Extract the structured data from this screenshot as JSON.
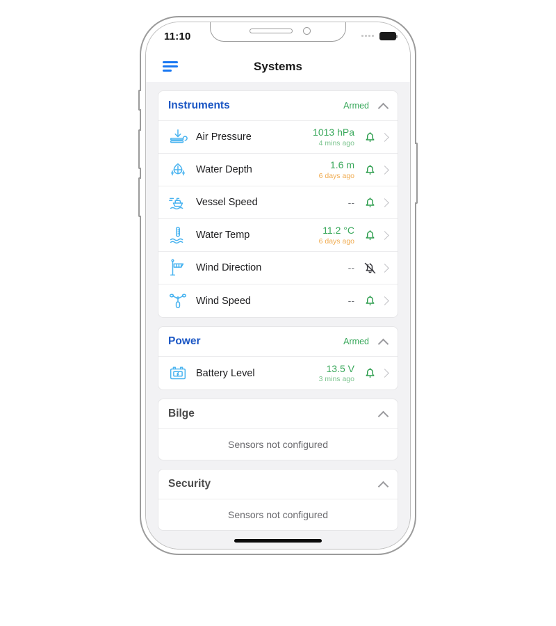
{
  "status_bar": {
    "time": "11:10",
    "signal_icon": "signal-dots-icon",
    "battery_icon": "battery-full-icon"
  },
  "navbar": {
    "menu_icon": "hamburger-menu-icon",
    "title": "Systems"
  },
  "colors": {
    "accent_blue": "#1a56c4",
    "menu_blue": "#1877f2",
    "armed_green": "#39a85b",
    "value_green": "#39a85b",
    "stale_orange": "#f0ab50",
    "icon_blue": "#48b3f0",
    "screen_bg": "#f2f2f4"
  },
  "sections": [
    {
      "title": "Instruments",
      "title_color": "blue",
      "status": "Armed",
      "collapse_icon": "chevron-up-icon",
      "rows": [
        {
          "icon": "air-pressure-icon",
          "label": "Air Pressure",
          "value": "1013 hPa",
          "time": "4 mins ago",
          "time_state": "fresh",
          "value_state": "active",
          "bell": "bell-icon",
          "chevron": "chevron-right-icon"
        },
        {
          "icon": "water-depth-icon",
          "label": "Water Depth",
          "value": "1.6 m",
          "time": "6 days ago",
          "time_state": "stale",
          "value_state": "active",
          "bell": "bell-icon",
          "chevron": "chevron-right-icon"
        },
        {
          "icon": "vessel-speed-icon",
          "label": "Vessel Speed",
          "value": "--",
          "time": "",
          "time_state": "none",
          "value_state": "empty",
          "bell": "bell-icon",
          "chevron": "chevron-right-icon"
        },
        {
          "icon": "water-temp-icon",
          "label": "Water Temp",
          "value": "11.2 °C",
          "time": "6 days ago",
          "time_state": "stale",
          "value_state": "active",
          "bell": "bell-icon",
          "chevron": "chevron-right-icon"
        },
        {
          "icon": "wind-direction-icon",
          "label": "Wind Direction",
          "value": "--",
          "time": "",
          "time_state": "none",
          "value_state": "empty",
          "bell": "bell-off-icon",
          "chevron": "chevron-right-icon"
        },
        {
          "icon": "wind-speed-icon",
          "label": "Wind Speed",
          "value": "--",
          "time": "",
          "time_state": "none",
          "value_state": "empty",
          "bell": "bell-icon",
          "chevron": "chevron-right-icon"
        }
      ]
    },
    {
      "title": "Power",
      "title_color": "blue",
      "status": "Armed",
      "collapse_icon": "chevron-up-icon",
      "rows": [
        {
          "icon": "battery-level-icon",
          "label": "Battery Level",
          "value": "13.5 V",
          "time": "3 mins ago",
          "time_state": "fresh",
          "value_state": "active",
          "bell": "bell-icon",
          "chevron": "chevron-right-icon"
        }
      ]
    },
    {
      "title": "Bilge",
      "title_color": "grey",
      "status": "",
      "collapse_icon": "chevron-up-icon",
      "empty_text": "Sensors not configured",
      "rows": []
    },
    {
      "title": "Security",
      "title_color": "grey",
      "status": "",
      "collapse_icon": "chevron-up-icon",
      "empty_text": "Sensors not configured",
      "rows": []
    }
  ]
}
